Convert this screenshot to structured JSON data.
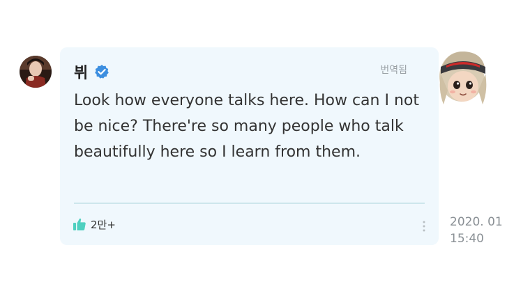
{
  "post": {
    "author": "뷔",
    "translated_label": "번역됨",
    "body": "Look how everyone talks here. How can I not be nice? There're so many people who talk beautifully here so I learn from them.",
    "like_count": "2만+",
    "timestamp": "2020. 01\n15:40"
  },
  "icons": {
    "verified": "verified-badge-icon",
    "like": "thumbs-up-icon",
    "more": "more-vertical-icon"
  },
  "colors": {
    "card_background": "#f0f8fd",
    "verified_blue": "#3d8fe0",
    "like_teal": "#4fd0c0"
  }
}
